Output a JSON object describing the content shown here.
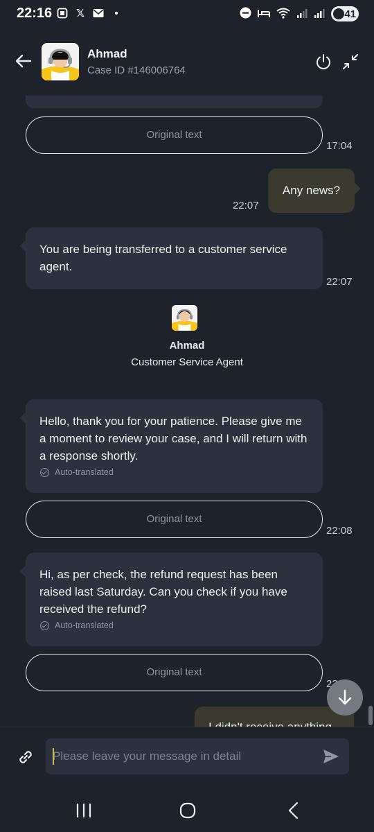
{
  "status_bar": {
    "time": "22:16",
    "battery": "41"
  },
  "header": {
    "agent_name": "Ahmad",
    "case_id": "Case ID #146006764",
    "icons": [
      "back-arrow-icon",
      "power-icon",
      "collapse-icon"
    ]
  },
  "messages": {
    "original_text_label": "Original text",
    "auto_translated_label": "Auto-translated",
    "time_1704": "17:04",
    "outgoing_1": "Any news?",
    "outgoing_1_time": "22:07",
    "system_1": "You are being transferred to a customer service agent.",
    "system_1_time": "22:07",
    "agent_name": "Ahmad",
    "agent_role": "Customer Service Agent",
    "agent_msg_1": "Hello, thank you for your patience. Please give me a moment to review your case, and I will return with a response shortly.",
    "agent_msg_1_time": "22:08",
    "agent_msg_2": "Hi, as per check, the refund request has been raised last Saturday. Can you check if you have received the refund?",
    "agent_msg_2_time": "22",
    "outgoing_2_partial": "I didn't receive anything"
  },
  "composer": {
    "placeholder": "Please leave your message in detail"
  },
  "colors": {
    "background": "#1e232b",
    "incoming_bubble": "#2b323d",
    "outgoing_bubble": "#3a3a2e",
    "avatar_yellow": "#f5c518"
  }
}
